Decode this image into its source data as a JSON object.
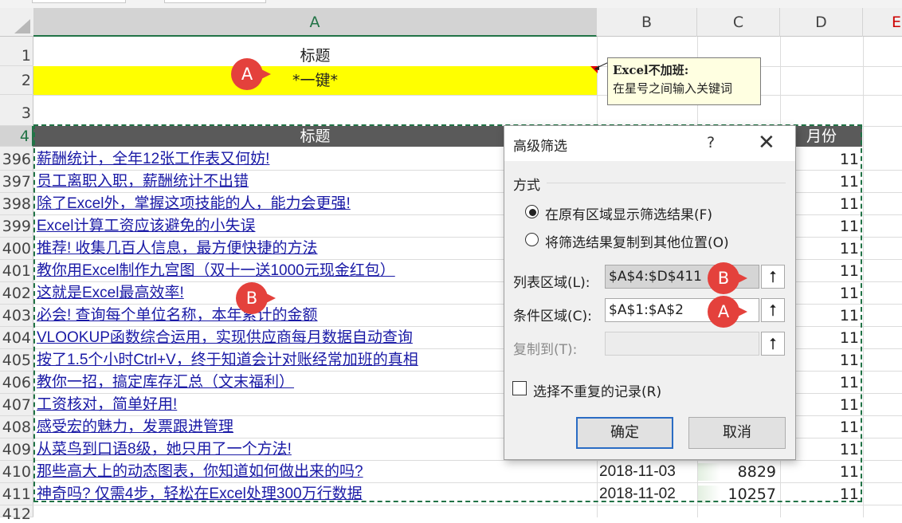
{
  "columns": [
    "A",
    "B",
    "C",
    "D"
  ],
  "rows": {
    "r1": {
      "num": "1",
      "title": "标题"
    },
    "r2": {
      "num": "2",
      "value": "*一键*"
    },
    "r3": {
      "num": "3"
    },
    "r4": {
      "num": "4",
      "title": "标题",
      "month": "月份"
    }
  },
  "comment": {
    "author": "Excel不加班:",
    "text": "在星号之间输入关键词"
  },
  "data_rows": [
    {
      "num": "396",
      "title": "薪酬统计，全年12张工作表又何妨!",
      "month": "11"
    },
    {
      "num": "397",
      "title": "员工离职入职，薪酬统计不出错",
      "month": "11"
    },
    {
      "num": "398",
      "title": "除了Excel外，掌握这项技能的人，能力会更强!",
      "month": "11"
    },
    {
      "num": "399",
      "title": "Excel计算工资应该避免的小失误",
      "month": "11"
    },
    {
      "num": "400",
      "title": "推荐! 收集几百人信息，最方便快捷的方法",
      "month": "11"
    },
    {
      "num": "401",
      "title": "教你用Excel制作九宫图（双十一送1000元现金红包）",
      "month": "11"
    },
    {
      "num": "402",
      "title": "这就是Excel最高效率!",
      "month": "11"
    },
    {
      "num": "403",
      "title": "必会! 查询每个单位名称，本年累计的金额",
      "month": "11"
    },
    {
      "num": "404",
      "title": "VLOOKUP函数综合运用，实现供应商每月数据自动查询",
      "month": "11"
    },
    {
      "num": "405",
      "title": "按了1.5个小时Ctrl+V，终于知道会计对账经常加班的真相",
      "month": "11"
    },
    {
      "num": "406",
      "title": "教你一招，搞定库存汇总（文末福利）",
      "month": "11"
    },
    {
      "num": "407",
      "title": "工资核对，简单好用!",
      "month": "11"
    },
    {
      "num": "408",
      "title": "感受宏的魅力，发票跟进管理",
      "month": "11"
    },
    {
      "num": "409",
      "title": "从菜鸟到口语8级，她只用了一个方法!",
      "month": "11"
    },
    {
      "num": "410",
      "title": "那些高大上的动态图表，你知道如何做出来的吗?",
      "date": "2018-11-03",
      "count": "8829",
      "month": "11"
    },
    {
      "num": "411",
      "title": "神奇吗? 仅需4步，轻松在Excel处理300万行数据",
      "date": "2018-11-02",
      "count": "10257",
      "month": "11"
    }
  ],
  "row_412": "412",
  "dialog": {
    "title": "高级筛选",
    "help": "?",
    "close": "✕",
    "section": "方式",
    "radio1": "在原有区域显示筛选结果(F)",
    "radio2": "将筛选结果复制到其他位置(O)",
    "list_label": "列表区域(L):",
    "list_value": "$A$4:$D$411",
    "criteria_label": "条件区域(C):",
    "criteria_value": "$A$1:$A$2",
    "copy_label": "复制到(T):",
    "copy_value": "",
    "unique_label": "选择不重复的记录(R)",
    "ok": "确定",
    "cancel": "取消",
    "picker_glyph": "⭡"
  },
  "markers": {
    "a": "A",
    "b": "B"
  },
  "colors": {
    "excel_green": "#217346",
    "marker_red": "#e4413c",
    "yellow": "#ffff00",
    "header_dark": "#5a5a5a",
    "link_blue": "#1a1aa6"
  }
}
